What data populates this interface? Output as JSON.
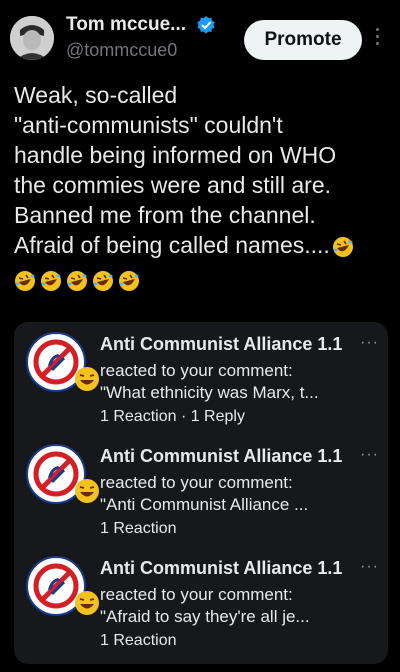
{
  "header": {
    "display_name": "Tom mccue...",
    "verified_icon": "verified-badge-icon",
    "handle": "@tommccue0",
    "promote_label": "Promote",
    "more_icon": "more-vertical-icon"
  },
  "post": {
    "lines": [
      "Weak, so-called",
      "\"anti-communists\" couldn't",
      "handle being informed on WHO",
      "the commies were and still are.",
      "Banned me from the channel.",
      "Afraid of being called names...."
    ],
    "emoji": "rolling-on-floor-laughing-emoji",
    "emoji_count": 5
  },
  "notifications": [
    {
      "title": "Anti Communist Alliance 1.1",
      "line1": "reacted to your comment:",
      "line2": "\"What ethnicity was Marx, t...",
      "meta": "1 Reaction · 1 Reply",
      "more": "···"
    },
    {
      "title": "Anti Communist Alliance 1.1",
      "line1": "reacted to your comment:",
      "line2": "\"Anti Communist Alliance ...",
      "meta": "1 Reaction",
      "more": "···"
    },
    {
      "title": "Anti Communist Alliance 1.1",
      "line1": "reacted to your comment:",
      "line2": "\"Afraid to say they're all je...",
      "meta": "1 Reaction",
      "more": "···"
    }
  ],
  "colors": {
    "background": "#000000",
    "card": "#16181c",
    "verified": "#1d9bf0",
    "emoji": "#f4c21e"
  }
}
